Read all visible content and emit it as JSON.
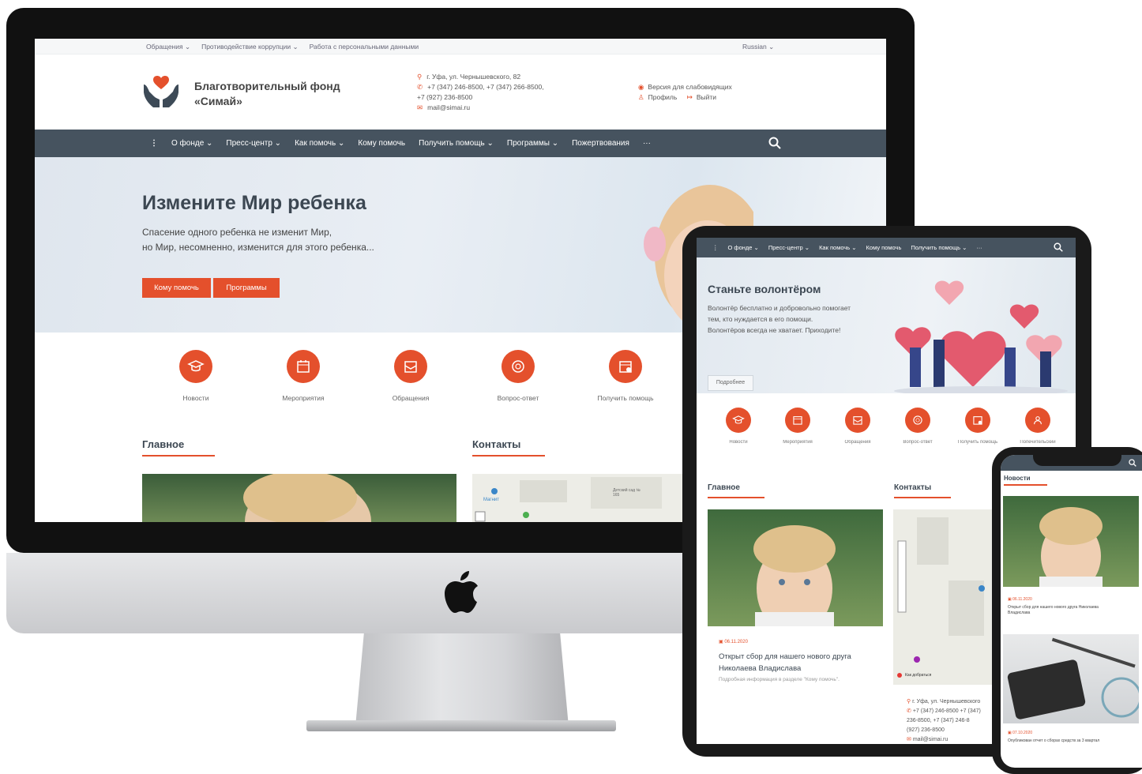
{
  "desktop": {
    "topbar": {
      "links": [
        "Обращения ⌄",
        "Противодействие коррупции ⌄",
        "Работа с персональными данными"
      ],
      "language": "Russian ⌄"
    },
    "header": {
      "org_name_line1": "Благотворительный фонд",
      "org_name_line2": "«Симай»",
      "address": "г. Уфа, ул. Чернышевского, 82",
      "phones_line1": "+7 (347) 246-8500, +7 (347) 266-8500,",
      "phones_line2": "+7 (927) 236-8500",
      "email": "mail@simai.ru",
      "accessibility": "Версия для слабовидящих",
      "profile": "Профиль",
      "logout": "Выйти"
    },
    "nav": {
      "items": [
        "О фонде ⌄",
        "Пресс-центр ⌄",
        "Как помочь ⌄",
        "Кому помочь",
        "Получить помощь ⌄",
        "Программы ⌄",
        "Пожертвования",
        "···"
      ]
    },
    "hero": {
      "title": "Измените Мир ребенка",
      "subtitle_line1": "Спасение одного ребенка не изменит Мир,",
      "subtitle_line2": "но Мир, несомненно, изменится для этого ребенка...",
      "btn_primary": "Кому помочь",
      "btn_secondary": "Программы"
    },
    "quick_links": [
      "Новости",
      "Мероприятия",
      "Обращения",
      "Вопрос-ответ",
      "Получить помощь"
    ],
    "sections": {
      "main": "Главное",
      "contacts": "Контакты"
    },
    "map_labels": [
      "Магнит",
      "Детский сад № 165"
    ]
  },
  "tablet": {
    "nav": {
      "items": [
        "О фонде ⌄",
        "Пресс-центр ⌄",
        "Как помочь ⌄",
        "Кому помочь",
        "Получить помощь ⌄",
        "···"
      ]
    },
    "hero": {
      "title": "Станьте волонтёром",
      "line1": "Волонтёр бесплатно и добровольно помогает",
      "line2": "тем, кто нуждается в его помощи.",
      "line3": "Волонтёров всегда не хватает. Приходите!",
      "more": "Подробнее"
    },
    "quick_links": [
      "Новости",
      "Мероприятия",
      "Обращения",
      "Вопрос-ответ",
      "Получить помощь",
      "Попечительский"
    ],
    "sections": {
      "main": "Главное",
      "contacts": "Контакты"
    },
    "news": {
      "date": "06.11.2020",
      "title_line1": "Открыт сбор для нашего нового друга",
      "title_line2": "Николаева Владислава",
      "desc": "Подробная информация в разделе \"Кому помочь\"."
    },
    "map_route": "Как добраться",
    "contacts": {
      "address": "г. Уфа, ул. Чернышевского",
      "phones_line1": "+7 (347) 246-8500 +7 (347)",
      "phones_line2": "236-8500, +7 (347) 246-8",
      "phones_line3": "(927) 236-8500",
      "email": "mail@simai.ru"
    }
  },
  "phone": {
    "section": "Новости",
    "news1": {
      "date": "06.11.2020",
      "title_line1": "Открыт сбор для нашего нового друга Николаева",
      "title_line2": "Владислава"
    },
    "news2": {
      "date": "07.10.2020",
      "title": "Опубликован отчет о сборах средств за 3 квартал"
    }
  },
  "colors": {
    "accent": "#e4502c",
    "nav": "#46535f"
  }
}
